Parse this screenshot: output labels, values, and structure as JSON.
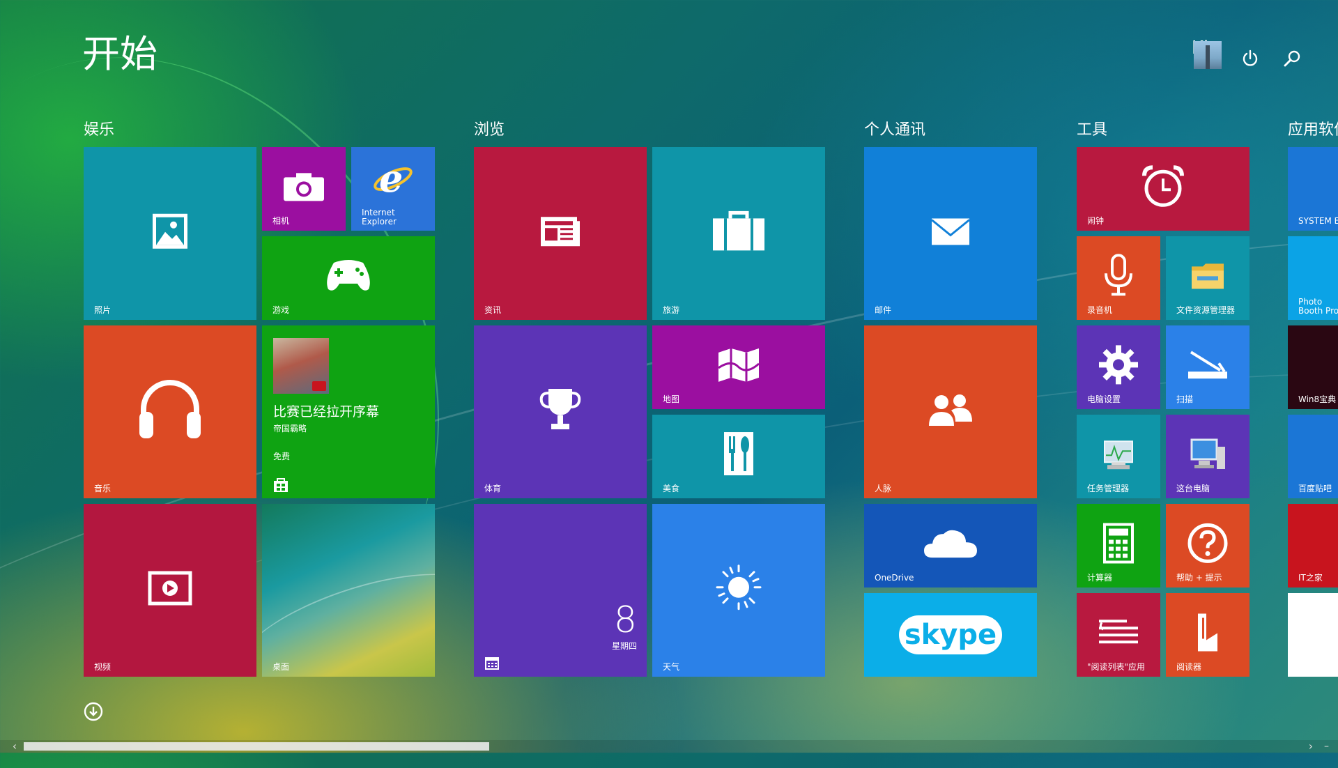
{
  "header": {
    "title": "开始",
    "user_name": "Kk",
    "user_sub": "Cc"
  },
  "groups": [
    {
      "id": "entertainment",
      "label": "娱乐"
    },
    {
      "id": "browse",
      "label": "浏览"
    },
    {
      "id": "personal",
      "label": "个人通讯"
    },
    {
      "id": "tools",
      "label": "工具"
    },
    {
      "id": "apps",
      "label": "应用软件"
    }
  ],
  "tiles": {
    "photos": {
      "label": "照片",
      "color": "#0f95a8"
    },
    "camera": {
      "label": "相机",
      "color": "#9b0fa0"
    },
    "ie": {
      "label": "Internet Explorer",
      "color": "#2b73d9"
    },
    "games": {
      "label": "游戏",
      "color": "#0fa312"
    },
    "music": {
      "label": "音乐",
      "color": "#dc4a24"
    },
    "store": {
      "headline": "比赛已经拉开序幕",
      "subtitle": "帝国霸略",
      "price": "免费",
      "color": "#0fa312"
    },
    "video": {
      "label": "视频",
      "color": "#b3173f"
    },
    "desktop": {
      "label": "桌面"
    },
    "news": {
      "label": "资讯",
      "color": "#b8193f"
    },
    "travel": {
      "label": "旅游",
      "color": "#0f95a8"
    },
    "sports": {
      "label": "体育",
      "color": "#5c34b6"
    },
    "maps": {
      "label": "地图",
      "color": "#9b0fa0"
    },
    "food": {
      "label": "美食",
      "color": "#0f95a8"
    },
    "calendar": {
      "day": "8",
      "weekday": "星期四",
      "color": "#5c34b6"
    },
    "weather": {
      "label": "天气",
      "color": "#2b81e8"
    },
    "mail": {
      "label": "邮件",
      "color": "#1180d8"
    },
    "people": {
      "label": "人脉",
      "color": "#dc4a24"
    },
    "onedrive": {
      "label": "OneDrive",
      "color": "#1456b8"
    },
    "skype": {
      "label": "skype",
      "color": "#0baee8"
    },
    "alarm": {
      "label": "闹钟",
      "color": "#b8193f"
    },
    "recorder": {
      "label": "录音机",
      "color": "#dc4a24"
    },
    "explorer": {
      "label": "文件资源管理器",
      "color": "#0f95a8"
    },
    "settings": {
      "label": "电脑设置",
      "color": "#5c34b6"
    },
    "scan": {
      "label": "扫描",
      "color": "#2b81e8"
    },
    "taskmgr": {
      "label": "任务管理器",
      "color": "#0f95a8"
    },
    "thispc": {
      "label": "这台电脑",
      "color": "#5c34b6"
    },
    "calculator": {
      "label": "计算器",
      "color": "#0fa312"
    },
    "help": {
      "label": "帮助 + 提示",
      "color": "#dc4a24"
    },
    "readinglist": {
      "label": "\"阅读列表\"应用",
      "color": "#b8193f"
    },
    "reader": {
      "label": "阅读器",
      "color": "#dc4a24"
    },
    "system": {
      "label": "SYSTEM E",
      "color": "#1b76d6"
    },
    "photobooth": {
      "label": "Photo Booth Pro",
      "color": "#0ba3e6"
    },
    "win8": {
      "label": "Win8宝典",
      "color": "#2a0712"
    },
    "baidu": {
      "label": "百度贴吧",
      "color": "#1b76d6"
    },
    "ithome": {
      "label": "IT之家",
      "color": "#c8141e"
    },
    "blank": {
      "color": "#ffffff"
    }
  }
}
